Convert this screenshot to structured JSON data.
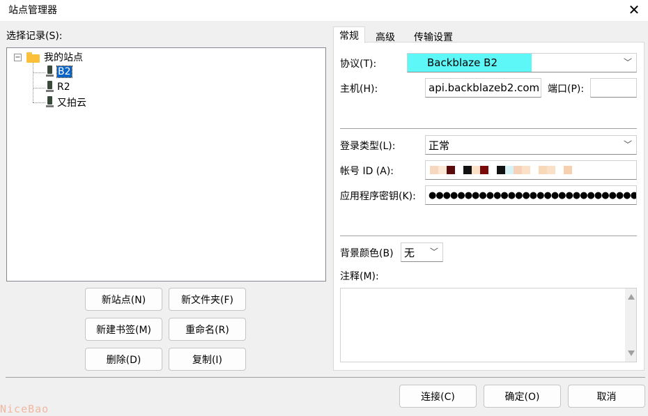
{
  "window": {
    "title": "站点管理器"
  },
  "left": {
    "select_label": "选择记录(S):",
    "tree": {
      "root": "我的站点",
      "expander": "−",
      "sites": [
        "B2",
        "R2",
        "又拍云"
      ]
    },
    "buttons": {
      "new_site": "新站点(N)",
      "new_folder": "新文件夹(F)",
      "new_bookmark": "新建书签(M)",
      "rename": "重命名(R)",
      "delete": "删除(D)",
      "copy": "复制(I)"
    }
  },
  "tabs": [
    "常规",
    "高级",
    "传输设置"
  ],
  "general": {
    "protocol_label": "协议(T):",
    "protocol_value": "Backblaze B2",
    "host_label": "主机(H):",
    "host_value": "api.backblazeb2.com",
    "port_label": "端口(P):",
    "port_value": "",
    "logon_type_label": "登录类型(L):",
    "logon_type_value": "正常",
    "account_label": "帐号 ID (A):",
    "key_label": "应用程序密钥(K):",
    "key_value": "●●●●●●●●●●●●●●●●●●●●●●●●●●●●●●●●●",
    "bgcolor_label": "背景颜色(B)",
    "bgcolor_value": "无",
    "comments_label": "注释(M):"
  },
  "footer": {
    "connect": "连接(C)",
    "ok": "确定(O)",
    "cancel": "取消"
  },
  "watermark": "NiceBao",
  "colors": {
    "protocol_highlight": "#5ef7f7",
    "selection": "#0a64c8"
  },
  "redaction_colors": [
    "#f7d7c0",
    "#fbe8d6",
    "#5a0a0a",
    "#ffffff",
    "#111111",
    "#fbe0c8",
    "#7a0a0a",
    "#ffffff",
    "#111111",
    "#d7f2f7",
    "#f7d0b8",
    "#fbe0c8",
    "#ffffff",
    "#f7d8b8",
    "#fbe0c8",
    "#ffffff",
    "#f7d0b0"
  ]
}
